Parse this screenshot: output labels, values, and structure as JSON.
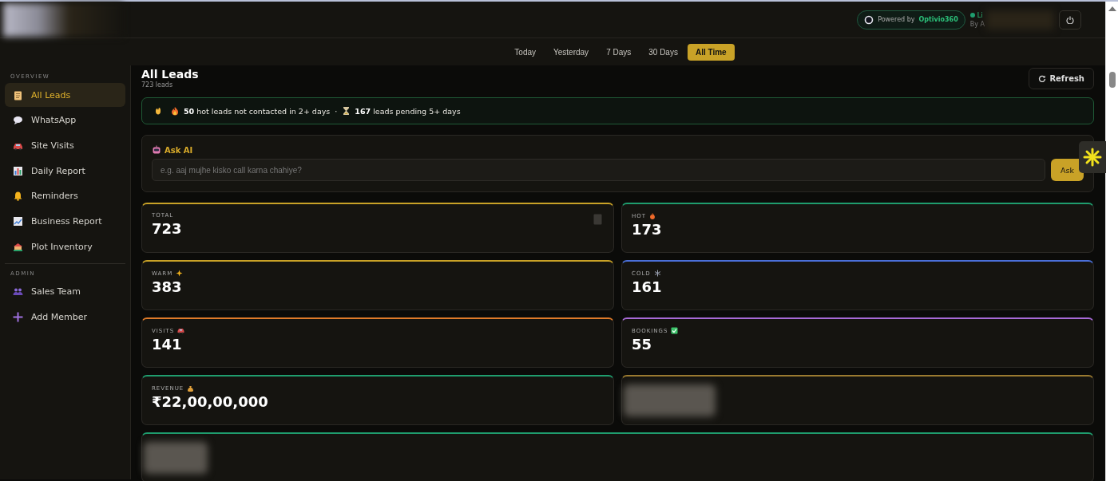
{
  "header": {
    "badge": {
      "prefix": "Powered by",
      "brand": "Optivio360"
    },
    "status": {
      "label": "Li",
      "by": "By A"
    }
  },
  "date_filters": [
    {
      "label": "Today",
      "selected": false
    },
    {
      "label": "Yesterday",
      "selected": false
    },
    {
      "label": "7 Days",
      "selected": false
    },
    {
      "label": "30 Days",
      "selected": false
    },
    {
      "label": "All Time",
      "selected": true
    }
  ],
  "sidebar": {
    "sections": [
      {
        "title": "OVERVIEW",
        "items": [
          {
            "label": "All Leads",
            "selected": true
          },
          {
            "label": "WhatsApp",
            "selected": false
          },
          {
            "label": "Site Visits",
            "selected": false
          },
          {
            "label": "Daily Report",
            "selected": false
          },
          {
            "label": "Reminders",
            "selected": false
          },
          {
            "label": "Business Report",
            "selected": false
          },
          {
            "label": "Plot Inventory",
            "selected": false
          }
        ]
      },
      {
        "title": "ADMIN",
        "items": [
          {
            "label": "Sales Team",
            "selected": false
          },
          {
            "label": "Add Member",
            "selected": false
          }
        ]
      }
    ]
  },
  "page": {
    "title": "All Leads",
    "subtitle": "723 leads",
    "refresh_button": "Refresh"
  },
  "alert": {
    "parts": [
      "**50** hot leads not contacted in 2+ days",
      "·",
      "**167** leads pending 5+ days"
    ]
  },
  "ask_ai": {
    "title": "Ask AI",
    "placeholder": "e.g. aaj mujhe kisko call karna chahiye?",
    "button": "Ask"
  },
  "stats": [
    {
      "kind": "value",
      "label": "TOTAL",
      "value": "723",
      "color": "#c9a227"
    },
    {
      "kind": "value",
      "label": "HOT",
      "value": "173",
      "color": "#1f9d6e"
    },
    {
      "kind": "value",
      "label": "WARM",
      "value": "383",
      "color": "#c9a227"
    },
    {
      "kind": "value",
      "label": "COLD",
      "value": "161",
      "color": "#4a6fd8"
    },
    {
      "kind": "value",
      "label": "VISITS",
      "value": "141",
      "color": "#e07b2a"
    },
    {
      "kind": "value",
      "label": "BOOKINGS",
      "value": "55",
      "color": "#a86ad8"
    },
    {
      "kind": "value",
      "label": "REVENUE",
      "value": "₹22,00,00,000",
      "color": "#1f9d6e"
    },
    {
      "kind": "redacted",
      "color": "#9a7a30"
    },
    {
      "kind": "redacted",
      "color": "#1f9d6e"
    }
  ]
}
